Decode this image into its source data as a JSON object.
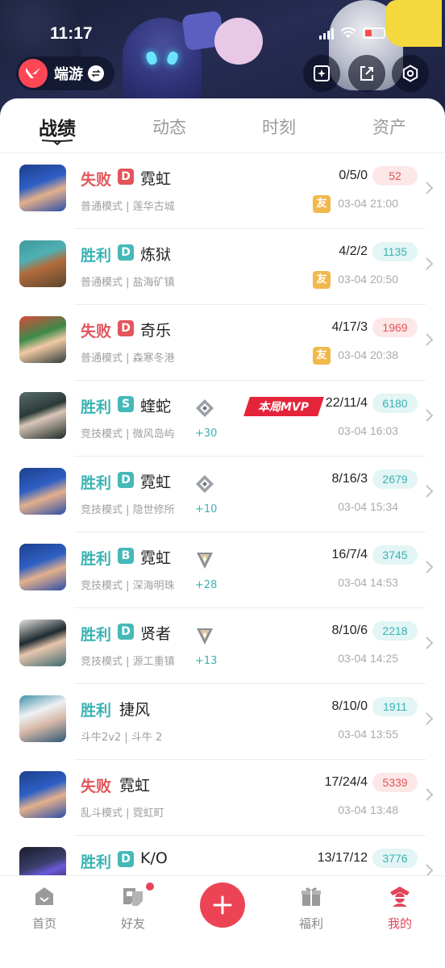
{
  "status": {
    "time": "11:17"
  },
  "header": {
    "brand": "端游",
    "colors": {
      "brand_red": "#ff4655"
    },
    "icons": [
      "swap-icon",
      "sparkle-frame-icon",
      "share-icon",
      "settings-icon"
    ]
  },
  "tabs": [
    {
      "label": "战绩",
      "active": true
    },
    {
      "label": "动态",
      "active": false
    },
    {
      "label": "时刻",
      "active": false
    },
    {
      "label": "资产",
      "active": false
    }
  ],
  "matches": [
    {
      "result": "失败",
      "outcome": "loss",
      "rank": "D",
      "agent": "霓虹",
      "meta": "普通模式 | 莲华古城",
      "kda": "0/5/0",
      "score": "52",
      "friend": "友",
      "time": "03-04 21:00"
    },
    {
      "result": "胜利",
      "outcome": "win",
      "rank": "D",
      "agent": "炼狱",
      "meta": "普通模式 | 盐海矿镇",
      "kda": "4/2/2",
      "score": "1135",
      "friend": "友",
      "time": "03-04 20:50"
    },
    {
      "result": "失败",
      "outcome": "loss",
      "rank": "D",
      "agent": "奇乐",
      "meta": "普通模式 | 森寒冬港",
      "kda": "4/17/3",
      "score": "1969",
      "friend": "友",
      "time": "03-04 20:38"
    },
    {
      "result": "胜利",
      "outcome": "win",
      "rank": "S",
      "agent": "蝰蛇",
      "meta": "竞技模式 | 微风岛屿",
      "kda": "22/11/4",
      "score": "6180",
      "rr": "+30",
      "mvp": "本局MVP",
      "time": "03-04 16:03"
    },
    {
      "result": "胜利",
      "outcome": "win",
      "rank": "D",
      "agent": "霓虹",
      "meta": "竞技模式 | 隐世修所",
      "kda": "8/16/3",
      "score": "2679",
      "rr": "+10",
      "time": "03-04 15:34"
    },
    {
      "result": "胜利",
      "outcome": "win",
      "rank": "B",
      "agent": "霓虹",
      "meta": "竞技模式 | 深海明珠",
      "kda": "16/7/4",
      "score": "3745",
      "rr": "+28",
      "time": "03-04 14:53"
    },
    {
      "result": "胜利",
      "outcome": "win",
      "rank": "D",
      "agent": "贤者",
      "meta": "竞技模式 | 源工重镇",
      "kda": "8/10/6",
      "score": "2218",
      "rr": "+13",
      "time": "03-04 14:25"
    },
    {
      "result": "胜利",
      "outcome": "win",
      "agent": "捷风",
      "meta": "斗牛2v2 | 斗牛 2",
      "kda": "8/10/0",
      "score": "1911",
      "time": "03-04 13:55"
    },
    {
      "result": "失败",
      "outcome": "loss",
      "agent": "霓虹",
      "meta": "乱斗模式 | 霓虹町",
      "kda": "17/24/4",
      "score": "5339",
      "time": "03-04 13:48"
    },
    {
      "result": "胜利",
      "outcome": "win",
      "rank": "D",
      "agent": "K/O",
      "meta": "",
      "kda": "13/17/12",
      "score": "3776",
      "time": ""
    }
  ],
  "nav": [
    {
      "label": "首页",
      "active": false
    },
    {
      "label": "好友",
      "active": false
    },
    {
      "label": "福利",
      "active": false
    },
    {
      "label": "我的",
      "active": true
    }
  ],
  "colors": {
    "win": "#3bb3b3",
    "loss": "#e2555b",
    "accent": "#ec4455"
  }
}
